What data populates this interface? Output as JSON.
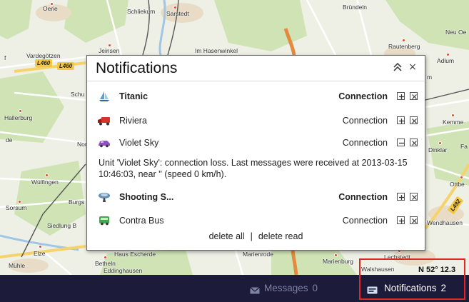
{
  "map": {
    "places": [
      {
        "name": "Oerie"
      },
      {
        "name": "Schliekum"
      },
      {
        "name": "Sarstedt"
      },
      {
        "name": "Bründeln"
      },
      {
        "name": "Neu Oe"
      },
      {
        "name": "Rautenberg"
      },
      {
        "name": "Adlum"
      },
      {
        "name": "Vardegötzen"
      },
      {
        "name": "Jeinsen"
      },
      {
        "name": "Im Hasenwinkel"
      },
      {
        "name": "Schu"
      },
      {
        "name": "Hallerburg"
      },
      {
        "name": "de"
      },
      {
        "name": "Nor"
      },
      {
        "name": "Kemme"
      },
      {
        "name": "Dinklar"
      },
      {
        "name": "Fa"
      },
      {
        "name": "Wülfingen"
      },
      {
        "name": "Ottbe"
      },
      {
        "name": "Burgs"
      },
      {
        "name": "Sorsum"
      },
      {
        "name": "Siedlung B"
      },
      {
        "name": "Wendhausen"
      },
      {
        "name": "Elze"
      },
      {
        "name": "Haus Escherde"
      },
      {
        "name": "Marienrode"
      },
      {
        "name": "Lechstedt"
      },
      {
        "name": "Marienburg"
      },
      {
        "name": "Mühle"
      },
      {
        "name": "Betheln"
      },
      {
        "name": "Eddinghausen"
      },
      {
        "name": "Walshausen"
      },
      {
        "name": "f"
      },
      {
        "name": "m"
      }
    ],
    "roads": [
      "L460",
      "L460",
      "L492"
    ],
    "coordinate": "N 52° 12.3"
  },
  "popup": {
    "title": "Notifications",
    "collapse_icon": "double-chevron-up-icon",
    "close_icon": "close-icon",
    "close_glyph": "×",
    "items": [
      {
        "unit": "Titanic",
        "event": "Connection",
        "unread": true,
        "icon": "sailboat-icon",
        "expanded": false
      },
      {
        "unit": "Riviera",
        "event": "Connection",
        "unread": false,
        "icon": "red-truck-icon",
        "expanded": false
      },
      {
        "unit": "Violet Sky",
        "event": "Connection",
        "unread": false,
        "icon": "purple-car-icon",
        "expanded": true
      },
      {
        "unit": "Shooting S...",
        "event": "Connection",
        "unread": true,
        "icon": "satellite-dish-icon",
        "expanded": false
      },
      {
        "unit": "Contra Bus",
        "event": "Connection",
        "unread": false,
        "icon": "green-bus-icon",
        "expanded": false
      }
    ],
    "detail": "Unit 'Violet Sky': connection loss. Last messages were received at 2013-03-15 10:46:03, near '' (speed 0 km/h).",
    "footer": {
      "delete_all": "delete all",
      "separator": "|",
      "delete_read": "delete read"
    }
  },
  "bottom_bar": {
    "messages": {
      "label": "Messages",
      "count": "0",
      "icon": "envelope-icon"
    },
    "notifications": {
      "label": "Notifications",
      "count": "2",
      "icon": "notification-card-icon"
    }
  },
  "colors": {
    "bar_background": "#1c1b3a",
    "highlight": "#e12525",
    "messages_text": "#7e82a0",
    "notifications_text": "#ffffff"
  }
}
